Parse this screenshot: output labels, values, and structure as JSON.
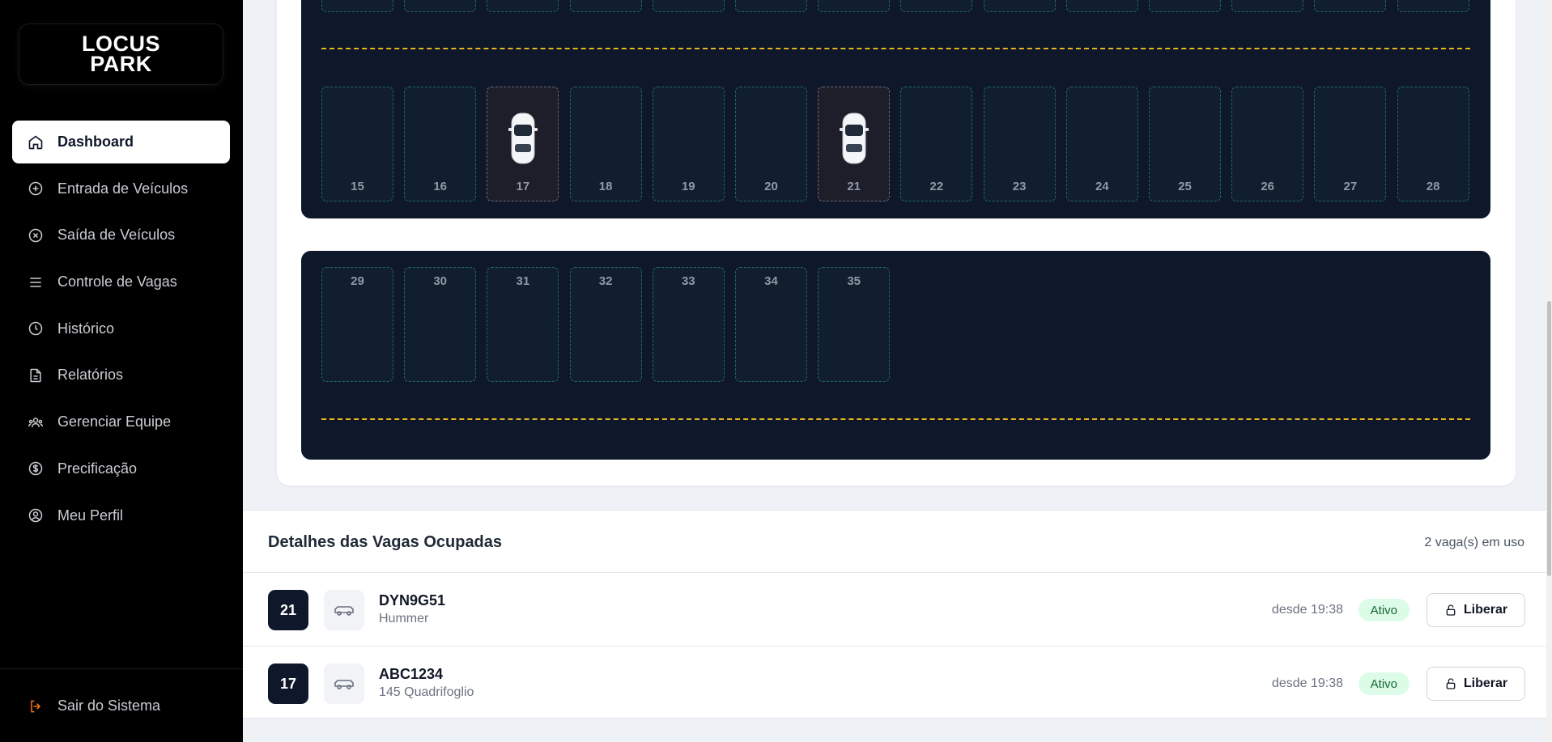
{
  "logo": {
    "line1": "LOCUS",
    "line2": "PARK"
  },
  "nav": [
    {
      "label": "Dashboard",
      "icon": "home-icon",
      "active": true
    },
    {
      "label": "Entrada de Veículos",
      "icon": "plus-circle-icon"
    },
    {
      "label": "Saída de Veículos",
      "icon": "x-circle-icon"
    },
    {
      "label": "Controle de Vagas",
      "icon": "menu-icon"
    },
    {
      "label": "Histórico",
      "icon": "clock-icon"
    },
    {
      "label": "Relatórios",
      "icon": "file-text-icon"
    },
    {
      "label": "Gerenciar Equipe",
      "icon": "users-icon"
    },
    {
      "label": "Precificação",
      "icon": "dollar-circle-icon"
    },
    {
      "label": "Meu Perfil",
      "icon": "user-circle-icon"
    }
  ],
  "logout": {
    "label": "Sair do Sistema",
    "icon": "logout-icon"
  },
  "parking": {
    "row_a": [
      "15",
      "16",
      "17",
      "18",
      "19",
      "20",
      "21",
      "22",
      "23",
      "24",
      "25",
      "26",
      "27",
      "28"
    ],
    "row_b": [
      "29",
      "30",
      "31",
      "32",
      "33",
      "34",
      "35"
    ],
    "occupied": [
      "17",
      "21"
    ]
  },
  "details": {
    "title": "Detalhes das Vagas Ocupadas",
    "count": "2 vaga(s) em uso",
    "rows": [
      {
        "spot": "21",
        "plate": "DYN9G51",
        "model": "Hummer",
        "since": "desde 19:38",
        "status": "Ativo",
        "action": "Liberar"
      },
      {
        "spot": "17",
        "plate": "ABC1234",
        "model": "145 Quadrifoglio",
        "since": "desde 19:38",
        "status": "Ativo",
        "action": "Liberar"
      }
    ]
  },
  "colors": {
    "accent": "#0f172a",
    "lane": "#e5b622",
    "spot_border": "#1f6b62",
    "status_bg": "#dcfce7"
  }
}
